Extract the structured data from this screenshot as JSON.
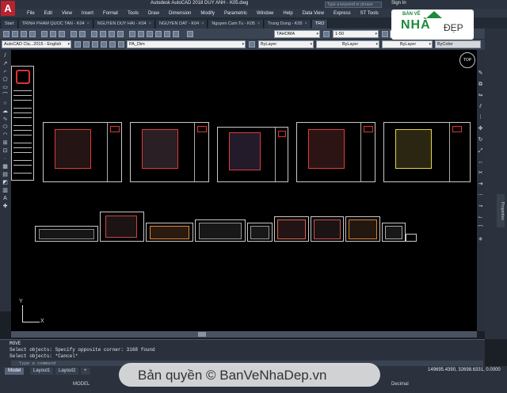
{
  "window": {
    "logo_letter": "A",
    "title": "Autodesk AutoCAD 2018   DUY ANH - K05.dwg",
    "search_placeholder": "Type a keyword or phrase",
    "signin": "Sign In"
  },
  "menu": [
    "File",
    "Edit",
    "View",
    "Insert",
    "Format",
    "Tools",
    "Draw",
    "Dimension",
    "Modify",
    "Parametric",
    "Window",
    "Help",
    "Data View",
    "Express",
    "ST Tools"
  ],
  "file_tabs": [
    {
      "label": "Start",
      "active": false
    },
    {
      "label": "TRINH PHAM QUOC TAN - K04",
      "active": false
    },
    {
      "label": "NGUYEN DUY HAI - K04",
      "active": false
    },
    {
      "label": "NGUYEN DAT - K04",
      "active": false
    },
    {
      "label": "Nguyen Cam Tu - K05",
      "active": false
    },
    {
      "label": "Trung Dung - K05",
      "active": false
    },
    {
      "label": "TRO",
      "active": true
    }
  ],
  "toolbar": {
    "workspace": "AutoCAD Cla...2015 - English",
    "textstyle": "TAHOMA",
    "scale": "1-50",
    "dimstyle_abbr": "St",
    "layer": "PA_Dim",
    "color": "ByLayer",
    "linetype": "ByLayer",
    "lineweight": "ByLayer",
    "plotstyle": "ByColor"
  },
  "command": {
    "lines": [
      "MOVE",
      "Select objects: Specify opposite corner: 3168 found",
      "Select objects: *Cancel*"
    ],
    "input_placeholder": "Type a command"
  },
  "layout_tabs": [
    {
      "label": "Model",
      "active": true
    },
    {
      "label": "Layout1",
      "active": false
    },
    {
      "label": "Layout2",
      "active": false
    },
    {
      "label": "+",
      "active": false
    }
  ],
  "status": {
    "coords": "149695.4390, 32698.6331, 0.0000",
    "model": "MODEL",
    "units": "Decimal"
  },
  "viewcube_label": "TOP",
  "properties_label": "Properties",
  "ucs": {
    "x": "X",
    "y": "Y"
  },
  "watermark": "Bản quyền © BanVeNhaDep.vn",
  "brand": {
    "top": "BẢN VẼ",
    "mid": "NHÀ",
    "right": "ĐẸP"
  }
}
